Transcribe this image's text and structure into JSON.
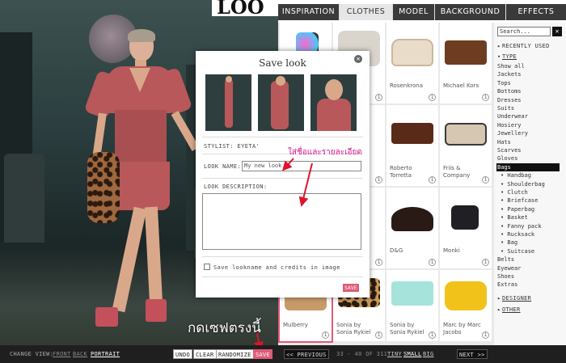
{
  "logo": {
    "text": "LOO"
  },
  "tabs": [
    {
      "label": "INSPIRATION",
      "active": false
    },
    {
      "label": "CLOTHES",
      "active": true
    },
    {
      "label": "MODEL",
      "active": false
    },
    {
      "label": "BACKGROUND",
      "active": false
    },
    {
      "label": "EFFECTS",
      "active": false
    }
  ],
  "sidebar": {
    "search_placeholder": "Search...",
    "search_button": "✕",
    "recently_used": "RECENTLY USED",
    "type": "TYPE",
    "items": [
      "Show all",
      "Jackets",
      "Tops",
      "Bottoms",
      "Dresses",
      "Suits",
      "Underwear",
      "Hosiery",
      "Jewellery",
      "Hats",
      "Scarves",
      "Gloves",
      "Bags"
    ],
    "subitems": [
      "• Handbag",
      "• Shoulderbag",
      "• Clutch",
      "• Briefcase",
      "• Paperbag",
      "• Basket",
      "• Fanny pack",
      "• Rucksack",
      "• Bag",
      "• Suitcase"
    ],
    "after": [
      "Belts",
      "Eyewear",
      "Shoes",
      "Extras"
    ],
    "designer": "DESIGNER",
    "other": "OTHER"
  },
  "grid": {
    "captions": [
      [
        "",
        "",
        "Rosenkrona",
        "Michael Kors"
      ],
      [
        "",
        "",
        "Roberto\nTorretta",
        "Friis &\nCompany"
      ],
      [
        "",
        "",
        "D&G",
        "Monki"
      ],
      [
        "Mulberry",
        "Sonia by\nSonia Rykiel",
        "Sonia by\nSonia Rykiel",
        "Marc by Marc\nJacobs"
      ]
    ],
    "count_badge": "1"
  },
  "pager": {
    "prev": "<< PREVIOUS",
    "range": "33 - 40 OF 311",
    "size_tiny": "TINY",
    "size_small": "SMALL",
    "size_big": "BIG",
    "next": "NEXT >>"
  },
  "toolbar": {
    "change_view": "CHANGE VIEW:",
    "front": "FRONT",
    "back": "BACK",
    "portrait": "PORTRAIT",
    "undo": "UNDO",
    "clear": "CLEAR",
    "randomize": "RANDOMIZE",
    "save": "SAVE"
  },
  "modal": {
    "title": "Save look",
    "close": "✕",
    "stylist": "STYLIST: EYETA'",
    "look_name_label": "LOOK NAME:",
    "look_name_value": "My new look",
    "look_description_label": "LOOK DESCRIPTION:",
    "checkbox_label": "Save lookname and credits in image",
    "save": "SAVE"
  },
  "annotations": {
    "modal_note": "ใส่ชื่อและรายละเอียด",
    "save_note": "กดเซฟตรงนี้"
  },
  "colors": {
    "accent": "#e05a78",
    "annotation_arrow": "#e0132a",
    "annotation_text": "#d4148c"
  }
}
